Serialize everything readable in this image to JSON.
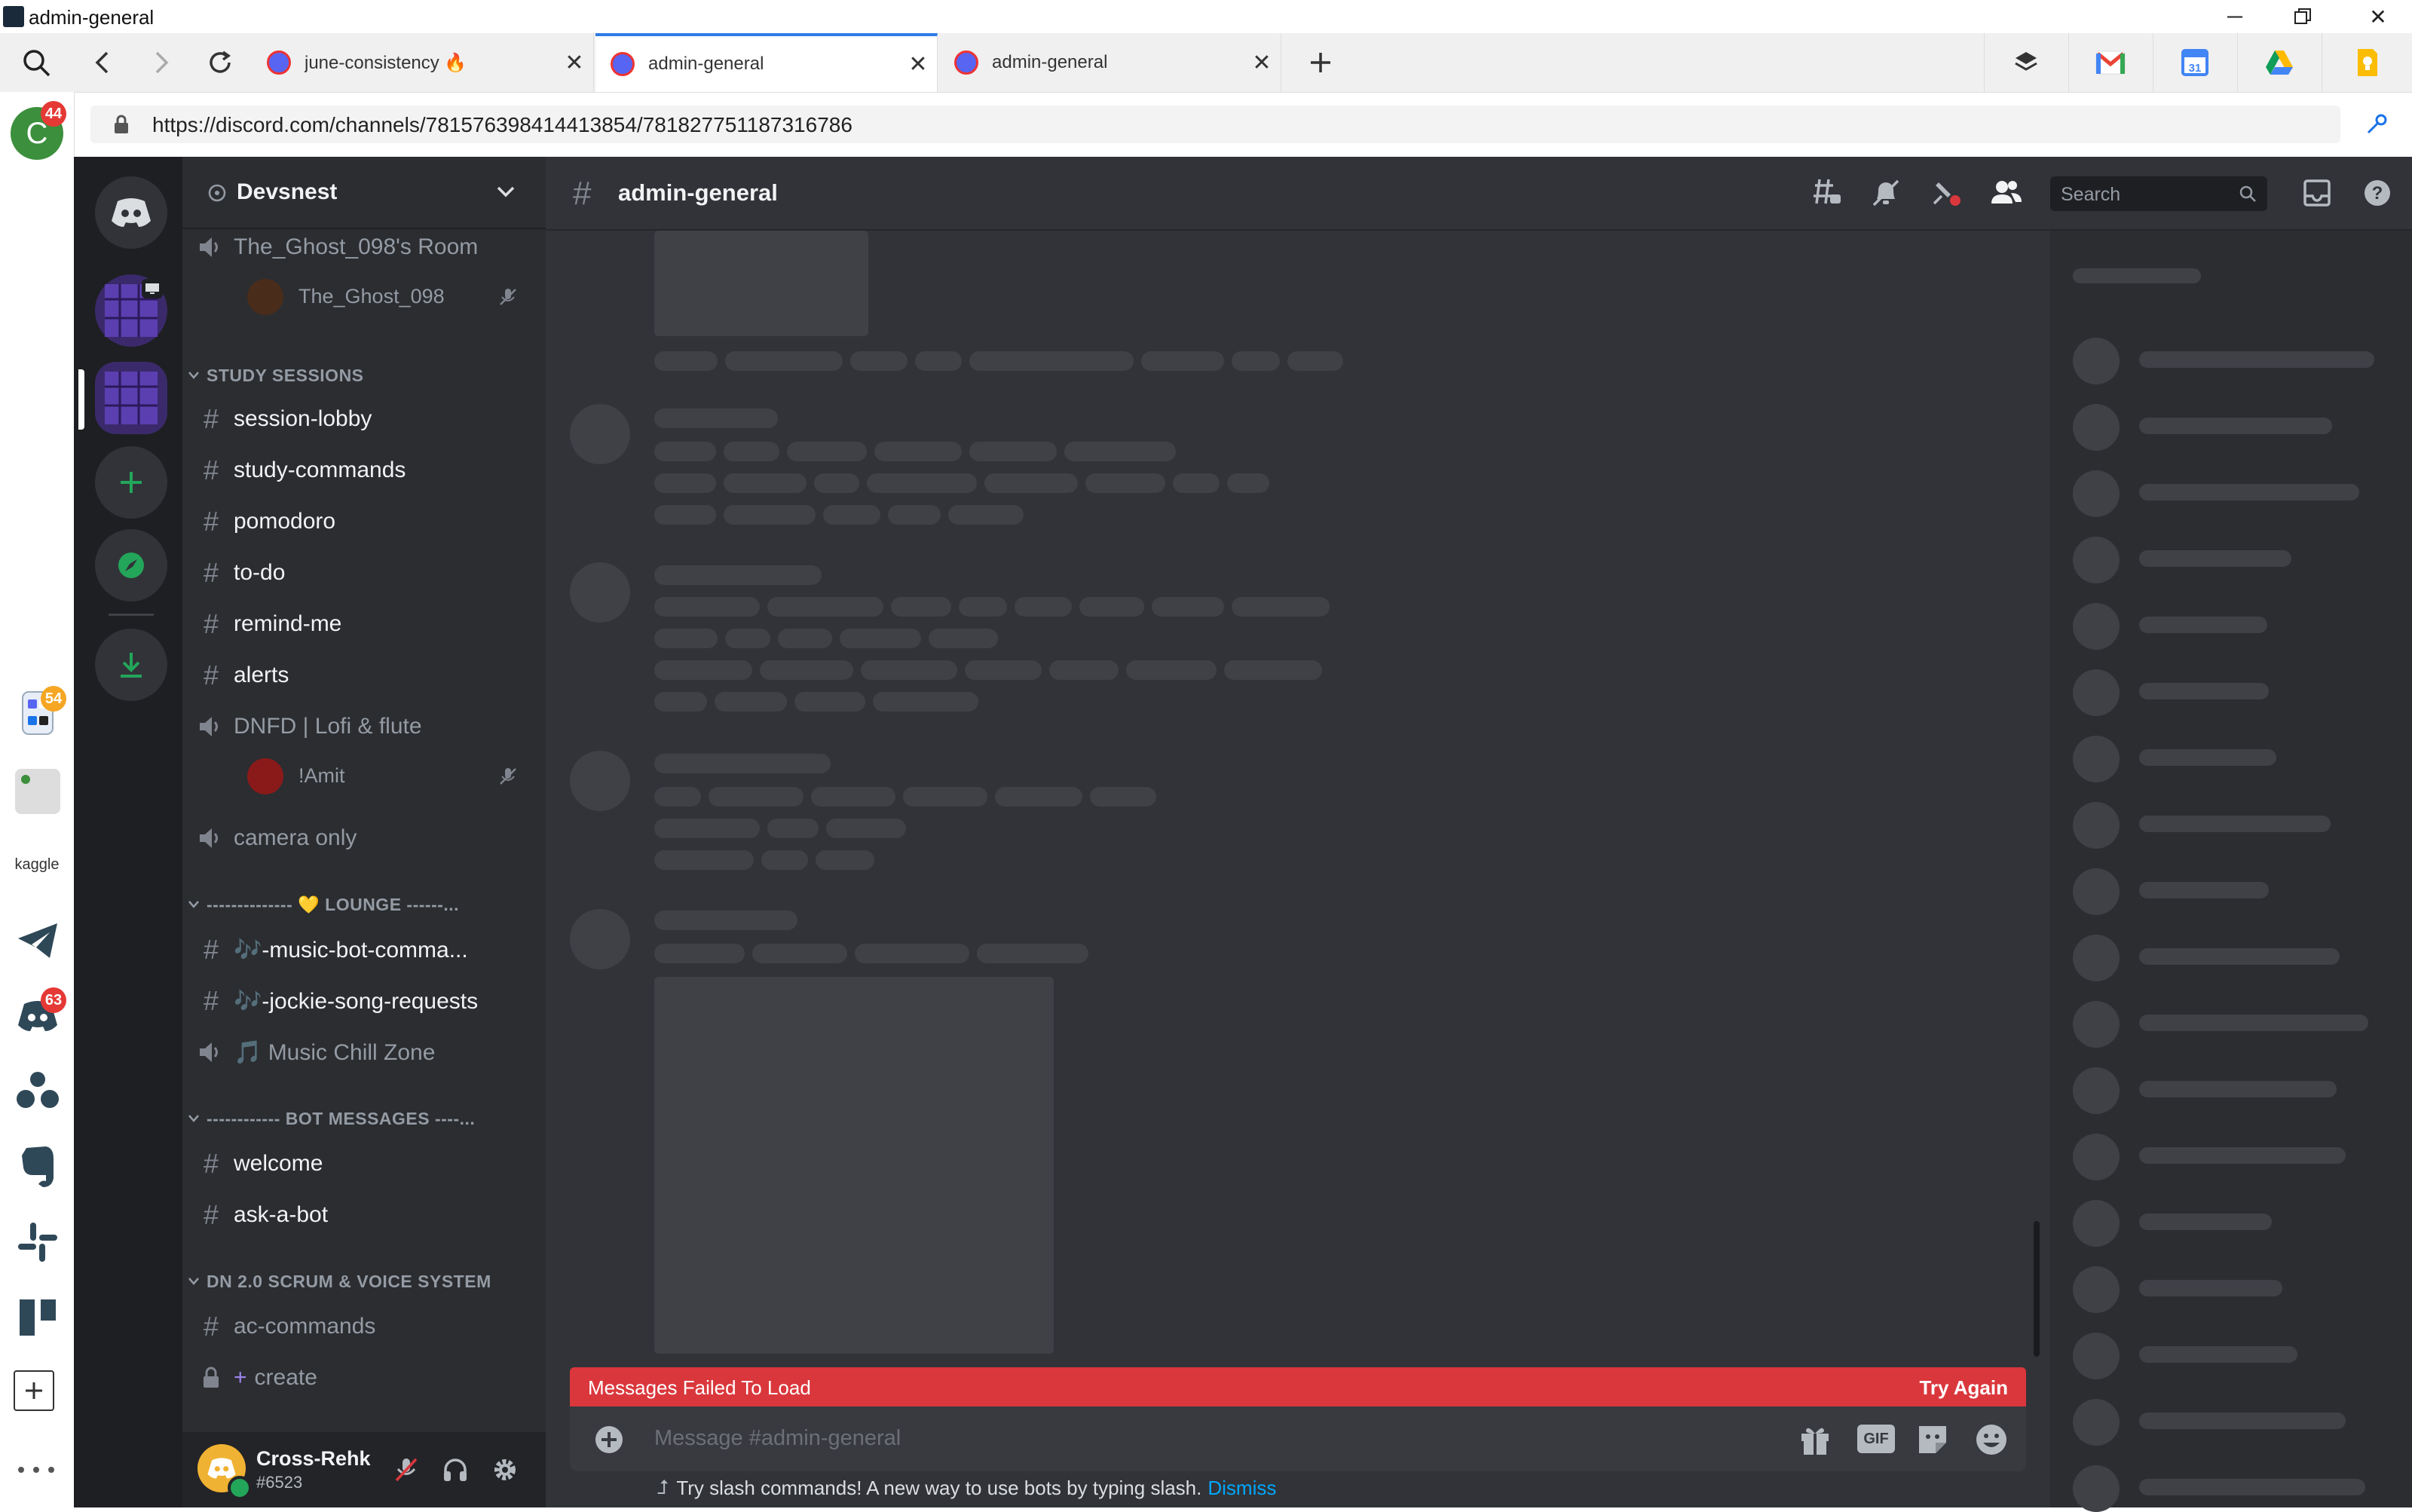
{
  "window": {
    "title": "admin-general",
    "controls": [
      "minimize",
      "restore",
      "close"
    ]
  },
  "tabs": [
    {
      "label": "june-consistency 🔥",
      "active": false
    },
    {
      "label": "admin-general",
      "active": true
    },
    {
      "label": "admin-general",
      "active": false
    }
  ],
  "address_bar": {
    "url": "https://discord.com/channels/781576398414413854/781827751187316786"
  },
  "browser_sidebar": {
    "profile_initial": "C",
    "profile_badge": "44",
    "workspace_badge": "54",
    "kaggle_label": "kaggle",
    "discord_badge": "63"
  },
  "server": {
    "name": "Devsnest"
  },
  "channels": {
    "voice_room_top": {
      "name": "The_Ghost_098's Room",
      "member": "The_Ghost_098"
    },
    "categories": [
      {
        "name": "STUDY SESSIONS",
        "items": [
          {
            "type": "text",
            "name": "session-lobby"
          },
          {
            "type": "text",
            "name": "study-commands"
          },
          {
            "type": "text",
            "name": "pomodoro"
          },
          {
            "type": "text",
            "name": "to-do"
          },
          {
            "type": "text",
            "name": "remind-me"
          },
          {
            "type": "text",
            "name": "alerts"
          },
          {
            "type": "voice",
            "name": "DNFD | Lofi & flute",
            "member": "!Amit"
          },
          {
            "type": "voice",
            "name": "camera only"
          }
        ]
      },
      {
        "name": "-------------- 💛 LOUNGE ------...",
        "items": [
          {
            "type": "text",
            "name": "🎶-music-bot-comma..."
          },
          {
            "type": "text",
            "name": "🎶-jockie-song-requests"
          },
          {
            "type": "voice",
            "name": "🎵 Music Chill Zone"
          }
        ]
      },
      {
        "name": "------------ BOT MESSAGES ----...",
        "items": [
          {
            "type": "text",
            "name": "welcome"
          },
          {
            "type": "text",
            "name": "ask-a-bot"
          }
        ]
      },
      {
        "name": "DN 2.0 SCRUM & VOICE SYSTEM",
        "items": [
          {
            "type": "text",
            "name": "ac-commands"
          },
          {
            "type": "locked",
            "name": "create"
          }
        ]
      }
    ]
  },
  "user_panel": {
    "username": "Cross-Rehk",
    "tag": "#6523"
  },
  "chat": {
    "channel_name": "admin-general",
    "search_placeholder": "Search",
    "error_message": "Messages Failed To Load",
    "retry_label": "Try Again",
    "input_placeholder": "Message #admin-general",
    "gif_label": "GIF",
    "hint_text": "Try slash commands! A new way to use bots by typing slash.",
    "dismiss_label": "Dismiss"
  },
  "colors": {
    "discord_blurple": "#5865f2",
    "error_red": "#da373c",
    "link_blue": "#00a8fc",
    "online_green": "#23a55a",
    "background": "#313338"
  }
}
